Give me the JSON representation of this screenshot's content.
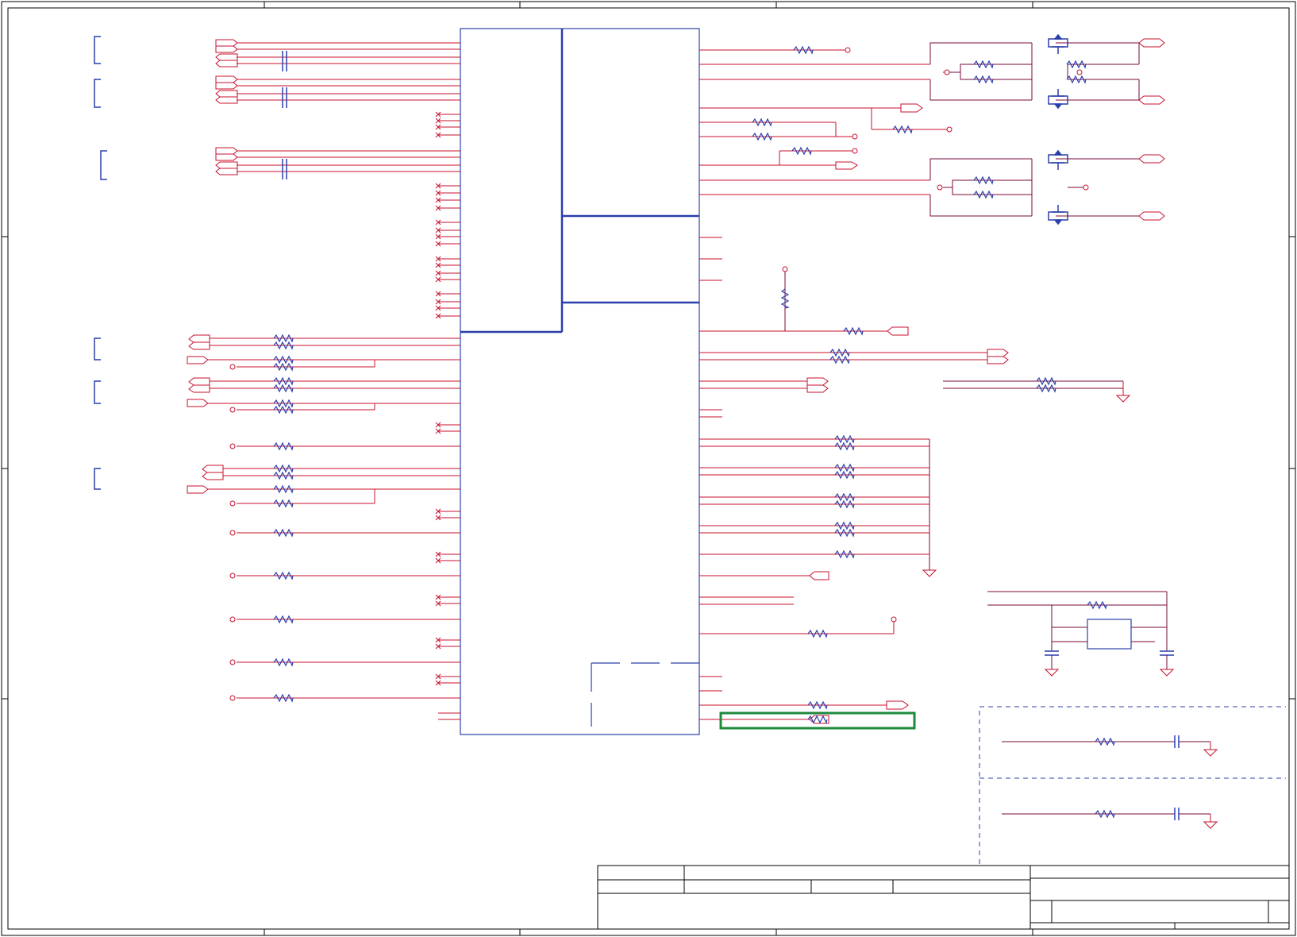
{
  "sheet": {
    "border_color": "#000000",
    "wire_color": "#c8102e",
    "net_color": "#7a0a3a",
    "component_color": "#2b3faa",
    "highlight_color": "#1e8a3c"
  },
  "title_block": {
    "title": "",
    "document_number": "",
    "revision": "",
    "sheet": ""
  }
}
